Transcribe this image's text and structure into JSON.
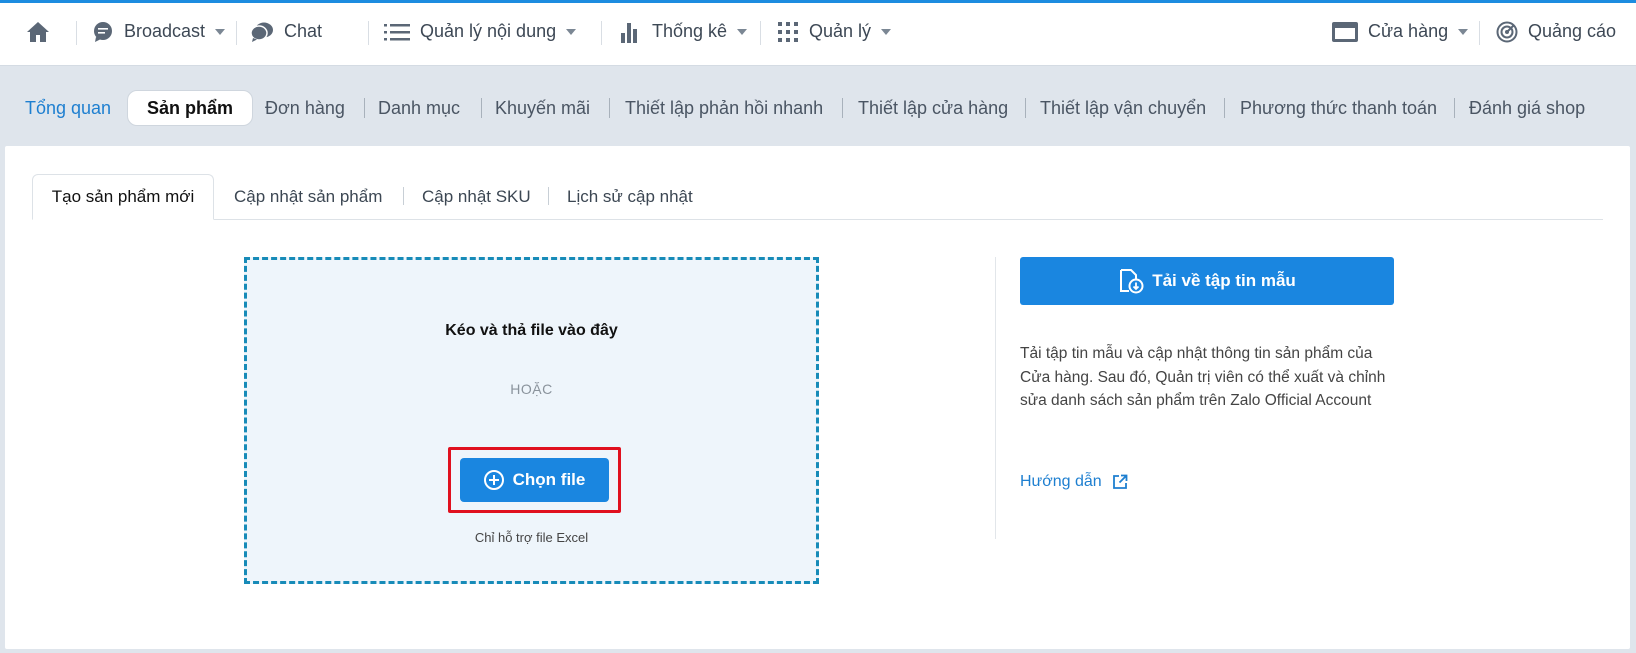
{
  "topnav": {
    "home_icon": "home-icon",
    "broadcast": "Broadcast",
    "chat": "Chat",
    "content": "Quản lý nội dung",
    "stats": "Thống kê",
    "manage": "Quản lý",
    "store": "Cửa hàng",
    "ads": "Quảng cáo"
  },
  "subnav": {
    "items": [
      "Tổng quan",
      "Sản phẩm",
      "Đơn hàng",
      "Danh mục",
      "Khuyến mãi",
      "Thiết lập phản hồi nhanh",
      "Thiết lập cửa hàng",
      "Thiết lập vận chuyển",
      "Phương thức thanh toán",
      "Đánh giá shop"
    ],
    "active": "Sản phẩm"
  },
  "tabs": {
    "items": [
      "Tạo sản phẩm mới",
      "Cập nhật sản phẩm",
      "Cập nhật SKU",
      "Lịch sử cập nhật"
    ],
    "active": "Tạo sản phẩm mới"
  },
  "dropzone": {
    "title": "Kéo và thả file vào đây",
    "or": "HOẶC",
    "choose_button": "Chọn file",
    "note": "Chỉ hỗ trợ file Excel"
  },
  "side": {
    "download_button": "Tải về tập tin mẫu",
    "description": "Tải tập tin mẫu và cập nhật thông tin sản phẩm của Cửa hàng. Sau đó, Quản trị viên có thể xuất và chỉnh sửa danh sách sản phẩm trên Zalo Official Account",
    "guide_link": "Hướng dẫn"
  },
  "colors": {
    "accent": "#1a86e0",
    "highlight": "#e0101e",
    "dashed_border": "#178bb8"
  }
}
